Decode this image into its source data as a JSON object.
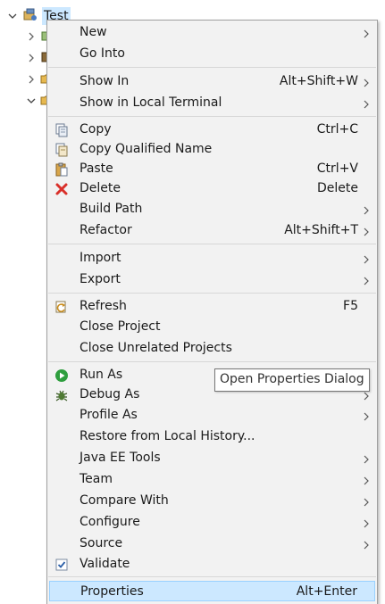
{
  "tree": {
    "project_label": "Test",
    "icons": [
      "chevron-down-icon",
      "project-icon",
      "chevron-right-icon",
      "package-icon",
      "folder-icon"
    ]
  },
  "menu": {
    "items": [
      {
        "label": "New",
        "accel": "",
        "submenu": true,
        "icon": ""
      },
      {
        "label": "Go Into",
        "accel": "",
        "submenu": false,
        "icon": ""
      },
      {
        "label": "Show In",
        "accel": "Alt+Shift+W",
        "submenu": true,
        "icon": ""
      },
      {
        "label": "Show in Local Terminal",
        "accel": "",
        "submenu": true,
        "icon": ""
      },
      {
        "label": "Copy",
        "accel": "Ctrl+C",
        "submenu": false,
        "icon": "copy-icon"
      },
      {
        "label": "Copy Qualified Name",
        "accel": "",
        "submenu": false,
        "icon": "copy-qualified-name-icon"
      },
      {
        "label": "Paste",
        "accel": "Ctrl+V",
        "submenu": false,
        "icon": "paste-icon"
      },
      {
        "label": "Delete",
        "accel": "Delete",
        "submenu": false,
        "icon": "delete-icon"
      },
      {
        "label": "Build Path",
        "accel": "",
        "submenu": true,
        "icon": ""
      },
      {
        "label": "Refactor",
        "accel": "Alt+Shift+T",
        "submenu": true,
        "icon": ""
      },
      {
        "label": "Import",
        "accel": "",
        "submenu": true,
        "icon": ""
      },
      {
        "label": "Export",
        "accel": "",
        "submenu": true,
        "icon": ""
      },
      {
        "label": "Refresh",
        "accel": "F5",
        "submenu": false,
        "icon": "refresh-icon"
      },
      {
        "label": "Close Project",
        "accel": "",
        "submenu": false,
        "icon": ""
      },
      {
        "label": "Close Unrelated Projects",
        "accel": "",
        "submenu": false,
        "icon": ""
      },
      {
        "label": "Run As",
        "accel": "",
        "submenu": true,
        "icon": "run-icon"
      },
      {
        "label": "Debug As",
        "accel": "",
        "submenu": true,
        "icon": "debug-icon"
      },
      {
        "label": "Profile As",
        "accel": "",
        "submenu": true,
        "icon": ""
      },
      {
        "label": "Restore from Local History...",
        "accel": "",
        "submenu": false,
        "icon": ""
      },
      {
        "label": "Java EE Tools",
        "accel": "",
        "submenu": true,
        "icon": ""
      },
      {
        "label": "Team",
        "accel": "",
        "submenu": true,
        "icon": ""
      },
      {
        "label": "Compare With",
        "accel": "",
        "submenu": true,
        "icon": ""
      },
      {
        "label": "Configure",
        "accel": "",
        "submenu": true,
        "icon": ""
      },
      {
        "label": "Source",
        "accel": "",
        "submenu": true,
        "icon": ""
      },
      {
        "label": "Validate",
        "accel": "",
        "submenu": false,
        "icon": "validate-checkbox-icon"
      },
      {
        "label": "Properties",
        "accel": "Alt+Enter",
        "submenu": false,
        "icon": "",
        "highlighted": true
      }
    ]
  },
  "tooltip": {
    "text": "Open Properties Dialog"
  },
  "colors": {
    "menu_bg": "#f2f2f2",
    "highlight_bg": "#cce8ff",
    "highlight_border": "#99d1ff",
    "separator": "#d7d7d7",
    "delete_red": "#d9302a",
    "run_green": "#2e9e3e"
  }
}
